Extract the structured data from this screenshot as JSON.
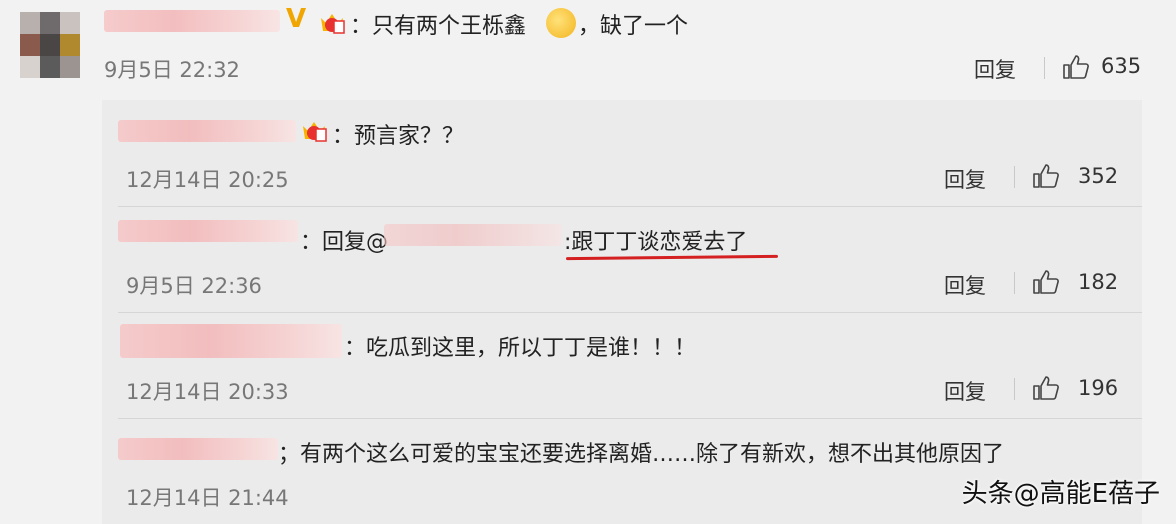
{
  "main_comment": {
    "text": "：只有两个王栎鑫",
    "text_after_emoji": "，缺了一个",
    "date": "9月5日 22:32",
    "reply_label": "回复",
    "likes": "635"
  },
  "replies": [
    {
      "text": "：预言家？？",
      "date": "12月14日 20:25",
      "reply_label": "回复",
      "likes": "352"
    },
    {
      "text_prefix": "：回复@",
      "text_highlight": ":跟丁丁谈恋爱去了",
      "date": "9月5日 22:36",
      "reply_label": "回复",
      "likes": "182"
    },
    {
      "text": "：吃瓜到这里，所以丁丁是谁！！！",
      "date": "12月14日 20:33",
      "reply_label": "回复",
      "likes": "196"
    },
    {
      "text": "；有两个这么可爱的宝宝还要选择离婚……除了有新欢，想不出其他原因了",
      "date": "12月14日 21:44",
      "reply_label": "",
      "likes": ""
    }
  ],
  "watermark": "头条@高能E蓓子",
  "colors": {
    "underline": "#d42020",
    "blur_pink": "#f3b8b9"
  },
  "icons": {
    "verified": "verified-v-icon",
    "member": "crown-badge-icon",
    "like": "thumbs-up-icon",
    "emoji": "doge-emoji-icon"
  }
}
